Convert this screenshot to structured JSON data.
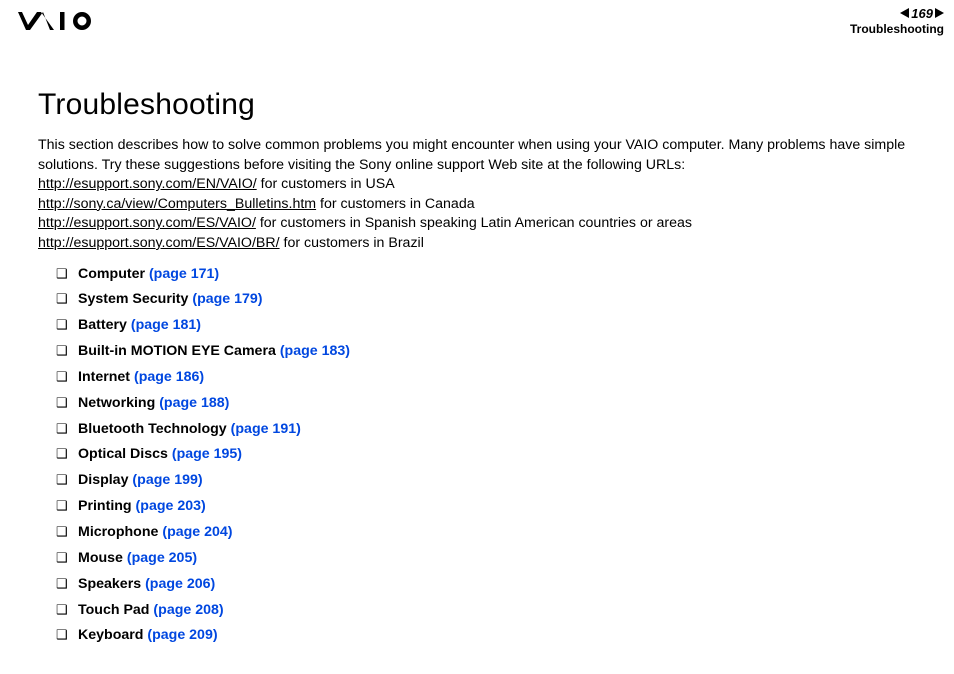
{
  "header": {
    "page_number": "169",
    "section_label": "Troubleshooting"
  },
  "title": "Troubleshooting",
  "intro_line1": "This section describes how to solve common problems you might encounter when using your VAIO computer. Many problems have simple solutions. Try these suggestions before visiting the Sony online support Web site at the following URLs:",
  "links": [
    {
      "url": "http://esupport.sony.com/EN/VAIO/",
      "suffix": " for customers in USA"
    },
    {
      "url": "http://sony.ca/view/Computers_Bulletins.htm",
      "suffix": " for customers in Canada"
    },
    {
      "url": "http://esupport.sony.com/ES/VAIO/",
      "suffix": " for customers in Spanish speaking Latin American countries or areas"
    },
    {
      "url": "http://esupport.sony.com/ES/VAIO/BR/",
      "suffix": " for customers in Brazil"
    }
  ],
  "toc": [
    {
      "label": "Computer",
      "page": "(page 171)"
    },
    {
      "label": "System Security",
      "page": "(page 179)"
    },
    {
      "label": "Battery",
      "page": "(page 181)"
    },
    {
      "label": "Built-in MOTION EYE Camera",
      "page": "(page 183)"
    },
    {
      "label": "Internet",
      "page": "(page 186)"
    },
    {
      "label": "Networking",
      "page": "(page 188)"
    },
    {
      "label": "Bluetooth Technology",
      "page": "(page 191)"
    },
    {
      "label": "Optical Discs",
      "page": "(page 195)"
    },
    {
      "label": "Display",
      "page": "(page 199)"
    },
    {
      "label": "Printing",
      "page": "(page 203)"
    },
    {
      "label": "Microphone",
      "page": "(page 204)"
    },
    {
      "label": "Mouse",
      "page": "(page 205)"
    },
    {
      "label": "Speakers",
      "page": "(page 206)"
    },
    {
      "label": "Touch Pad",
      "page": "(page 208)"
    },
    {
      "label": "Keyboard",
      "page": "(page 209)"
    }
  ]
}
